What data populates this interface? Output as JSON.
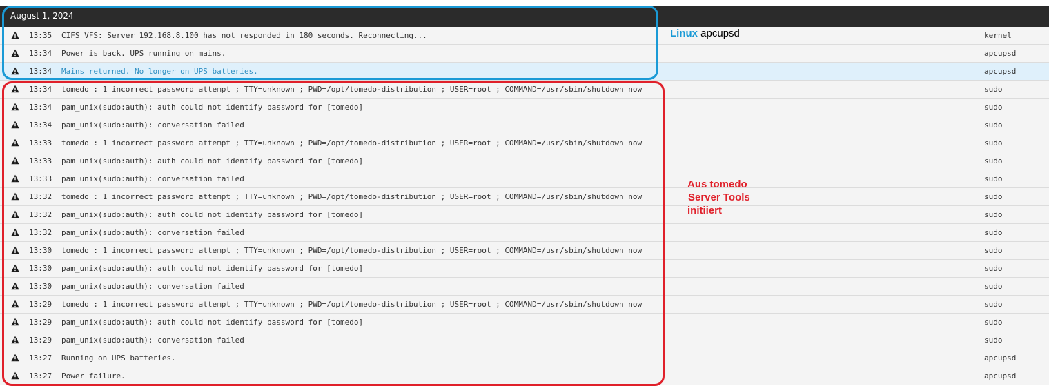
{
  "date_header": "August 1, 2024",
  "rows": [
    {
      "time": "13:35",
      "message": "CIFS VFS: Server 192.168.8.100 has not responded in 180 seconds. Reconnecting...",
      "source": "kernel",
      "highlight": false
    },
    {
      "time": "13:34",
      "message": "Power is back. UPS running on mains.",
      "source": "apcupsd",
      "highlight": false
    },
    {
      "time": "13:34",
      "message": "Mains returned. No longer on UPS batteries.",
      "source": "apcupsd",
      "highlight": true
    },
    {
      "time": "13:34",
      "message": "tomedo : 1 incorrect password attempt ; TTY=unknown ; PWD=/opt/tomedo-distribution ; USER=root ; COMMAND=/usr/sbin/shutdown now",
      "source": "sudo",
      "highlight": false
    },
    {
      "time": "13:34",
      "message": "pam_unix(sudo:auth): auth could not identify password for [tomedo]",
      "source": "sudo",
      "highlight": false
    },
    {
      "time": "13:34",
      "message": "pam_unix(sudo:auth): conversation failed",
      "source": "sudo",
      "highlight": false
    },
    {
      "time": "13:33",
      "message": "tomedo : 1 incorrect password attempt ; TTY=unknown ; PWD=/opt/tomedo-distribution ; USER=root ; COMMAND=/usr/sbin/shutdown now",
      "source": "sudo",
      "highlight": false
    },
    {
      "time": "13:33",
      "message": "pam_unix(sudo:auth): auth could not identify password for [tomedo]",
      "source": "sudo",
      "highlight": false
    },
    {
      "time": "13:33",
      "message": "pam_unix(sudo:auth): conversation failed",
      "source": "sudo",
      "highlight": false
    },
    {
      "time": "13:32",
      "message": "tomedo : 1 incorrect password attempt ; TTY=unknown ; PWD=/opt/tomedo-distribution ; USER=root ; COMMAND=/usr/sbin/shutdown now",
      "source": "sudo",
      "highlight": false
    },
    {
      "time": "13:32",
      "message": "pam_unix(sudo:auth): auth could not identify password for [tomedo]",
      "source": "sudo",
      "highlight": false
    },
    {
      "time": "13:32",
      "message": "pam_unix(sudo:auth): conversation failed",
      "source": "sudo",
      "highlight": false
    },
    {
      "time": "13:30",
      "message": "tomedo : 1 incorrect password attempt ; TTY=unknown ; PWD=/opt/tomedo-distribution ; USER=root ; COMMAND=/usr/sbin/shutdown now",
      "source": "sudo",
      "highlight": false
    },
    {
      "time": "13:30",
      "message": "pam_unix(sudo:auth): auth could not identify password for [tomedo]",
      "source": "sudo",
      "highlight": false
    },
    {
      "time": "13:30",
      "message": "pam_unix(sudo:auth): conversation failed",
      "source": "sudo",
      "highlight": false
    },
    {
      "time": "13:29",
      "message": "tomedo : 1 incorrect password attempt ; TTY=unknown ; PWD=/opt/tomedo-distribution ; USER=root ; COMMAND=/usr/sbin/shutdown now",
      "source": "sudo",
      "highlight": false
    },
    {
      "time": "13:29",
      "message": "pam_unix(sudo:auth): auth could not identify password for [tomedo]",
      "source": "sudo",
      "highlight": false
    },
    {
      "time": "13:29",
      "message": "pam_unix(sudo:auth): conversation failed",
      "source": "sudo",
      "highlight": false
    },
    {
      "time": "13:27",
      "message": "Running on UPS batteries.",
      "source": "apcupsd",
      "highlight": false
    },
    {
      "time": "13:27",
      "message": "Power failure.",
      "source": "apcupsd",
      "highlight": false
    }
  ],
  "annotations": {
    "linux_bold": "Linux",
    "linux_rest": "apcupsd",
    "tomedo_lines": [
      "Aus tomedo",
      "Server Tools",
      "initiiert"
    ]
  },
  "colors": {
    "header_bg": "#2b2b2b",
    "row_bg": "#f4f4f4",
    "highlight_bg": "#dff0fb",
    "highlight_text": "#2f8fc2",
    "annotation_blue": "#1a9ad6",
    "annotation_red": "#e0202a"
  },
  "icons": {
    "row_icon": "warning-triangle-icon"
  }
}
